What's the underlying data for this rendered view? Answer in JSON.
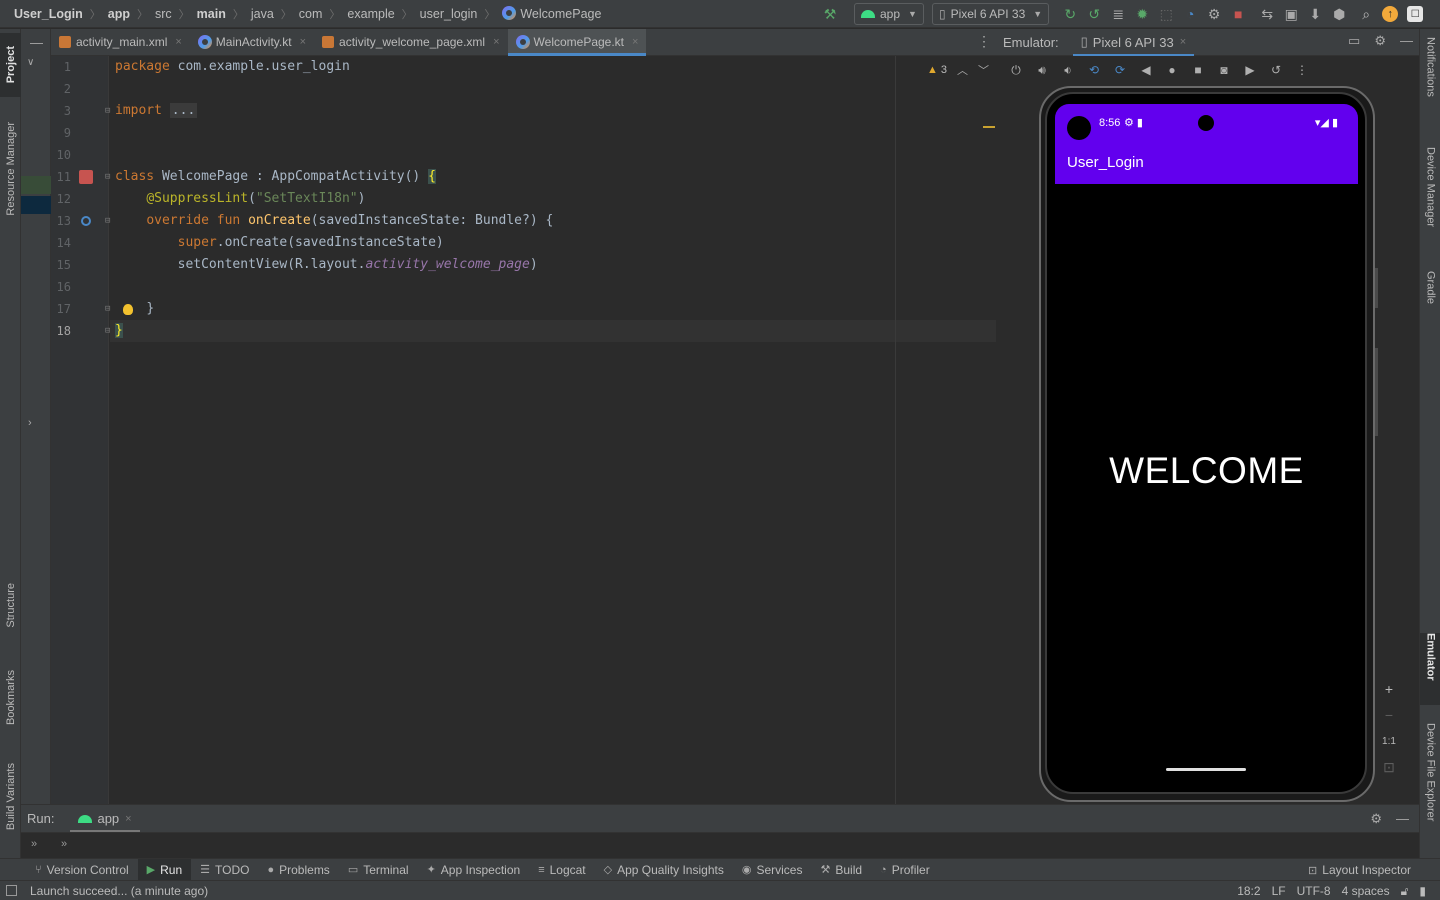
{
  "breadcrumbs": [
    "User_Login",
    "app",
    "src",
    "main",
    "java",
    "com",
    "example",
    "user_login",
    "WelcomePage"
  ],
  "toolbar": {
    "run_config": "app",
    "device": "Pixel 6 API 33"
  },
  "left_tabs": [
    "Project",
    "Resource Manager",
    "Structure",
    "Bookmarks",
    "Build Variants"
  ],
  "right_tabs": [
    "Notifications",
    "Device Manager",
    "Gradle",
    "Emulator",
    "Device File Explorer"
  ],
  "editor_tabs": [
    {
      "label": "activity_main.xml",
      "type": "xml"
    },
    {
      "label": "MainActivity.kt",
      "type": "kotlin"
    },
    {
      "label": "activity_welcome_page.xml",
      "type": "xml"
    },
    {
      "label": "WelcomePage.kt",
      "type": "kotlin",
      "active": true
    }
  ],
  "editor": {
    "line_numbers": [
      "1",
      "2",
      "3",
      "9",
      "10",
      "11",
      "12",
      "13",
      "14",
      "15",
      "16",
      "17",
      "18"
    ],
    "current_line": "18",
    "code": {
      "l1_kw": "package",
      "l1_rest": " com.example.user_login",
      "l3_kw": "import",
      "l3_fold": "...",
      "l11_kw": "class",
      "l11_rest": " WelcomePage : AppCompatActivity() ",
      "l11_brace": "{",
      "l12_ann": "@SuppressLint",
      "l12_paren_open": "(",
      "l12_str": "\"SetTextI18n\"",
      "l12_paren_close": ")",
      "l13_kw": "override fun",
      "l13_fn": "onCreate",
      "l13_rest": "(savedInstanceState: Bundle?) {",
      "l14_kw": "super",
      "l14_rest": ".onCreate(savedInstanceState)",
      "l15_rest": "setContentView(R.layout.",
      "l15_prop": "activity_welcome_page",
      "l15_close": ")",
      "l17": "}",
      "l18": "}"
    },
    "warnings_count": "3"
  },
  "emulator": {
    "label": "Emulator:",
    "device_tab": "Pixel 6 API 33",
    "phone": {
      "time": "8:56",
      "app_title": "User_Login",
      "welcome_text": "WELCOME"
    },
    "zoom": {
      "plus": "+",
      "minus": "−",
      "one_to_one": "1:1"
    }
  },
  "run_panel": {
    "label": "Run:",
    "tab": "app"
  },
  "bottom_tools": [
    "Version Control",
    "Run",
    "TODO",
    "Problems",
    "Terminal",
    "App Inspection",
    "Logcat",
    "App Quality Insights",
    "Services",
    "Build",
    "Profiler"
  ],
  "bottom_right_tool": "Layout Inspector",
  "status": {
    "message": "Launch succeed... (a minute ago)",
    "position": "18:2",
    "line_sep": "LF",
    "encoding": "UTF-8",
    "indent": "4 spaces"
  },
  "colors": {
    "accent": "#4a88c7",
    "app_bar": "#6200ee",
    "android_green": "#3ddc84"
  }
}
